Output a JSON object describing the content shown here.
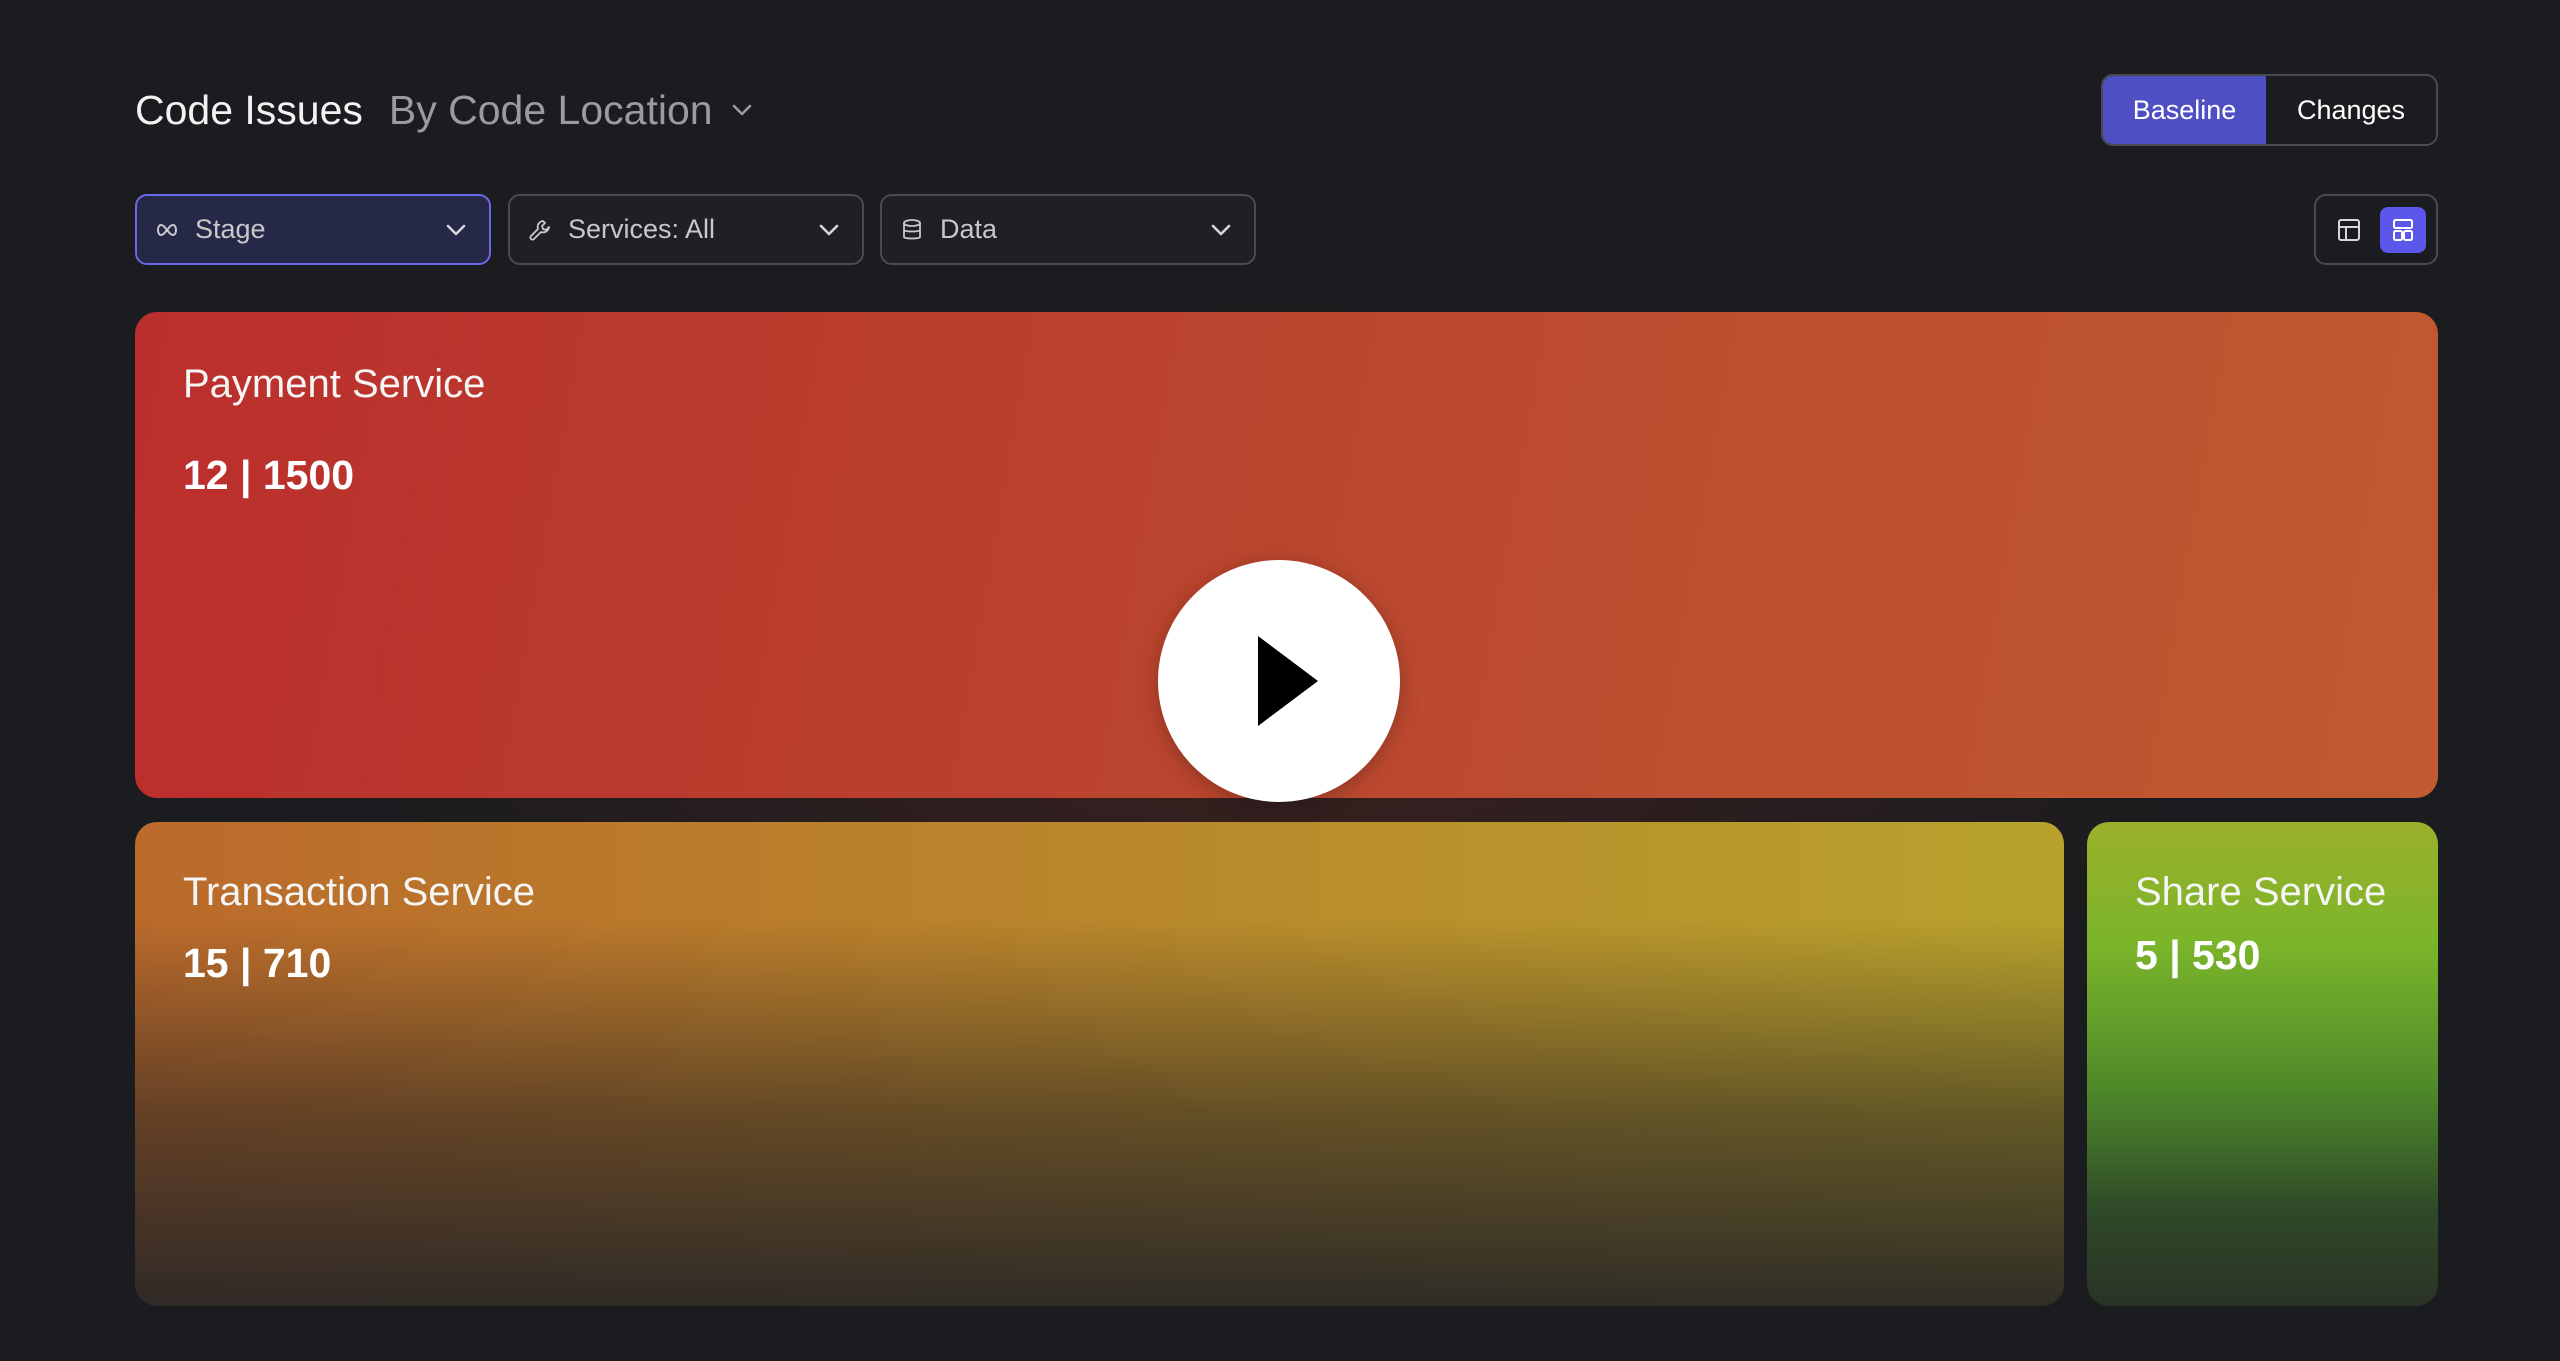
{
  "header": {
    "title": "Code Issues",
    "grouping": "By Code Location"
  },
  "mode_toggle": {
    "baseline_label": "Baseline",
    "changes_label": "Changes",
    "selected": "Baseline"
  },
  "filters": {
    "stage": {
      "label": "Stage",
      "icon": "infinity-icon"
    },
    "services": {
      "label": "Services: All",
      "icon": "wrench-icon"
    },
    "data": {
      "label": "Data",
      "icon": "database-icon"
    }
  },
  "view": {
    "options": [
      "table-view-icon",
      "tile-view-icon"
    ],
    "selected": "tile-view-icon"
  },
  "services": [
    {
      "name": "Payment Service",
      "stat": "12 | 1500"
    },
    {
      "name": "Transaction Service",
      "stat": "15 | 710"
    },
    {
      "name": "Share Service",
      "stat": "5 | 530"
    }
  ],
  "colors": {
    "accent": "#5a57ea",
    "baseline_active": "#4f4fc4",
    "payment": "#bc4b2f",
    "transaction": "#b98a2b",
    "share": "#7bb52a"
  },
  "overlay": {
    "icon": "play-icon"
  }
}
